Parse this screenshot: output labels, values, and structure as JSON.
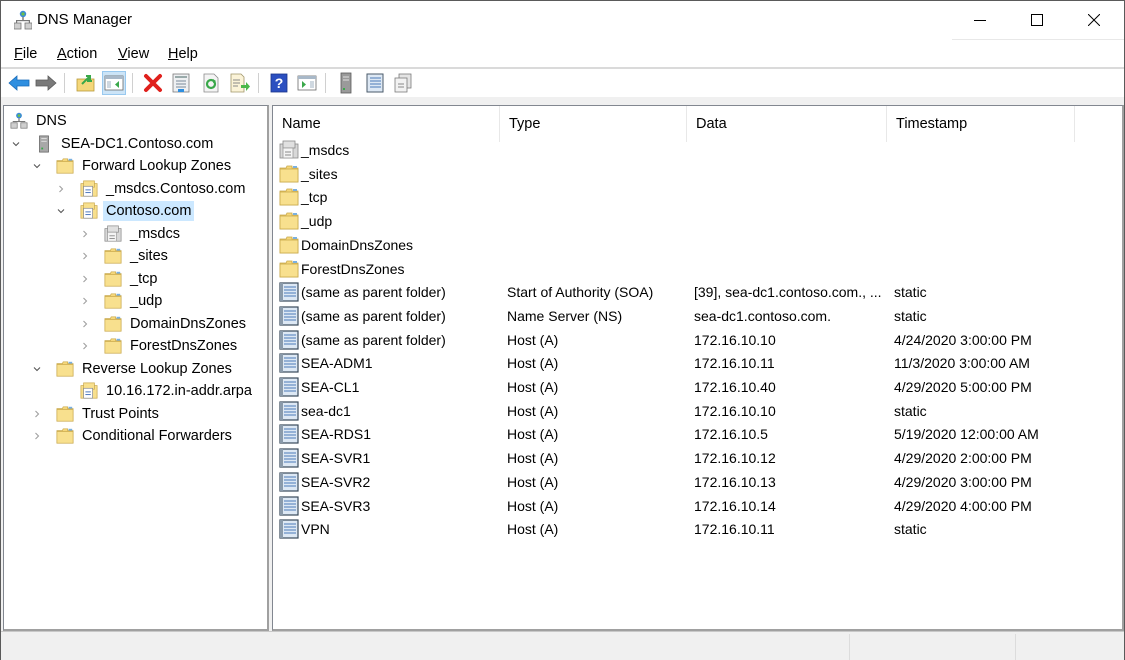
{
  "window": {
    "title": "DNS Manager",
    "app_icon": "dns-manager-icon",
    "controls": [
      "minimize",
      "maximize",
      "close"
    ]
  },
  "menu": {
    "items": [
      {
        "label": "File",
        "accel": "F"
      },
      {
        "label": "Action",
        "accel": "A"
      },
      {
        "label": "View",
        "accel": "V"
      },
      {
        "label": "Help",
        "accel": "H"
      }
    ]
  },
  "toolbar": {
    "buttons": [
      {
        "name": "back",
        "icon": "back-arrow-icon"
      },
      {
        "name": "forward",
        "icon": "forward-arrow-icon"
      },
      {
        "name": "up-one-level",
        "icon": "up-folder-icon"
      },
      {
        "name": "show-hide-console-tree",
        "icon": "console-tree-icon",
        "active": true
      },
      {
        "name": "delete",
        "icon": "delete-icon"
      },
      {
        "name": "properties",
        "icon": "properties-icon"
      },
      {
        "name": "refresh",
        "icon": "refresh-icon"
      },
      {
        "name": "export-list",
        "icon": "export-list-icon"
      },
      {
        "name": "help",
        "icon": "help-icon"
      },
      {
        "name": "show-hide-action-pane",
        "icon": "action-pane-icon"
      },
      {
        "name": "server",
        "icon": "server-icon"
      },
      {
        "name": "new-record",
        "icon": "record-icon"
      },
      {
        "name": "copy-records",
        "icon": "copy-records-icon"
      }
    ]
  },
  "tree": {
    "nodes": [
      {
        "label": "DNS",
        "icon": "dns-root-icon",
        "level": 0,
        "expander": "none"
      },
      {
        "label": "SEA-DC1.Contoso.com",
        "icon": "server-icon",
        "level": 1,
        "expander": "expanded"
      },
      {
        "label": "Forward Lookup Zones",
        "icon": "folder-icon",
        "level": 2,
        "expander": "expanded"
      },
      {
        "label": "_msdcs.Contoso.com",
        "icon": "zone-icon",
        "level": 3,
        "expander": "collapsed"
      },
      {
        "label": "Contoso.com",
        "icon": "zone-icon",
        "level": 3,
        "expander": "expanded",
        "selected": true
      },
      {
        "label": "_msdcs",
        "icon": "delegated-zone-icon",
        "level": 4,
        "expander": "collapsed"
      },
      {
        "label": "_sites",
        "icon": "folder-icon",
        "level": 4,
        "expander": "collapsed"
      },
      {
        "label": "_tcp",
        "icon": "folder-icon",
        "level": 4,
        "expander": "collapsed"
      },
      {
        "label": "_udp",
        "icon": "folder-icon",
        "level": 4,
        "expander": "collapsed"
      },
      {
        "label": "DomainDnsZones",
        "icon": "folder-icon",
        "level": 4,
        "expander": "collapsed"
      },
      {
        "label": "ForestDnsZones",
        "icon": "folder-icon",
        "level": 4,
        "expander": "collapsed"
      },
      {
        "label": "Reverse Lookup Zones",
        "icon": "folder-icon",
        "level": 2,
        "expander": "expanded"
      },
      {
        "label": "10.16.172.in-addr.arpa",
        "icon": "zone-icon",
        "level": 3,
        "expander": "none"
      },
      {
        "label": "Trust Points",
        "icon": "folder-icon",
        "level": 2,
        "expander": "collapsed"
      },
      {
        "label": "Conditional Forwarders",
        "icon": "folder-icon",
        "level": 2,
        "expander": "collapsed"
      }
    ]
  },
  "list": {
    "columns": [
      "Name",
      "Type",
      "Data",
      "Timestamp"
    ],
    "rows": [
      {
        "name": "_msdcs",
        "type": "",
        "data": "",
        "timestamp": "",
        "icon": "delegated-zone-icon"
      },
      {
        "name": "_sites",
        "type": "",
        "data": "",
        "timestamp": "",
        "icon": "folder-icon"
      },
      {
        "name": "_tcp",
        "type": "",
        "data": "",
        "timestamp": "",
        "icon": "folder-icon"
      },
      {
        "name": "_udp",
        "type": "",
        "data": "",
        "timestamp": "",
        "icon": "folder-icon"
      },
      {
        "name": "DomainDnsZones",
        "type": "",
        "data": "",
        "timestamp": "",
        "icon": "folder-icon"
      },
      {
        "name": "ForestDnsZones",
        "type": "",
        "data": "",
        "timestamp": "",
        "icon": "folder-icon"
      },
      {
        "name": "(same as parent folder)",
        "type": "Start of Authority (SOA)",
        "data": "[39], sea-dc1.contoso.com., ...",
        "timestamp": "static",
        "icon": "record-icon"
      },
      {
        "name": "(same as parent folder)",
        "type": "Name Server (NS)",
        "data": "sea-dc1.contoso.com.",
        "timestamp": "static",
        "icon": "record-icon"
      },
      {
        "name": "(same as parent folder)",
        "type": "Host (A)",
        "data": "172.16.10.10",
        "timestamp": "4/24/2020 3:00:00 PM",
        "icon": "record-icon"
      },
      {
        "name": "SEA-ADM1",
        "type": "Host (A)",
        "data": "172.16.10.11",
        "timestamp": "11/3/2020 3:00:00 AM",
        "icon": "record-icon"
      },
      {
        "name": "SEA-CL1",
        "type": "Host (A)",
        "data": "172.16.10.40",
        "timestamp": "4/29/2020 5:00:00 PM",
        "icon": "record-icon"
      },
      {
        "name": "sea-dc1",
        "type": "Host (A)",
        "data": "172.16.10.10",
        "timestamp": "static",
        "icon": "record-icon"
      },
      {
        "name": "SEA-RDS1",
        "type": "Host (A)",
        "data": "172.16.10.5",
        "timestamp": "5/19/2020 12:00:00 AM",
        "icon": "record-icon"
      },
      {
        "name": "SEA-SVR1",
        "type": "Host (A)",
        "data": "172.16.10.12",
        "timestamp": "4/29/2020 2:00:00 PM",
        "icon": "record-icon"
      },
      {
        "name": "SEA-SVR2",
        "type": "Host (A)",
        "data": "172.16.10.13",
        "timestamp": "4/29/2020 3:00:00 PM",
        "icon": "record-icon"
      },
      {
        "name": "SEA-SVR3",
        "type": "Host (A)",
        "data": "172.16.10.14",
        "timestamp": "4/29/2020 4:00:00 PM",
        "icon": "record-icon"
      },
      {
        "name": "VPN",
        "type": "Host (A)",
        "data": "172.16.10.11",
        "timestamp": "static",
        "icon": "record-icon"
      }
    ]
  },
  "colors": {
    "selection": "#cce8ff",
    "toolbar_active": "#cce4f7",
    "folder": "#f5d77a",
    "delete": "#e0201c",
    "help": "#2b4fc0"
  }
}
